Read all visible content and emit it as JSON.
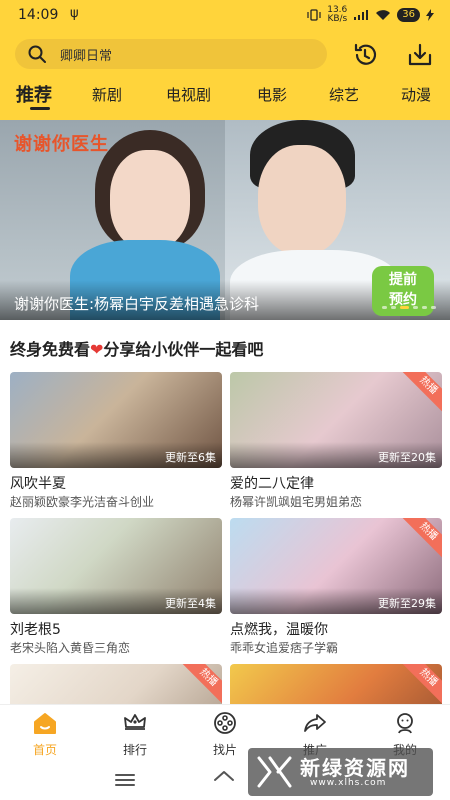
{
  "status_bar": {
    "time": "14:09",
    "usb": "ψ",
    "signal": "13.6\nKB/s",
    "battery": "36"
  },
  "search": {
    "text": "卿卿日常"
  },
  "tabs": [
    "推荐",
    "新剧",
    "电视剧",
    "电影",
    "综艺",
    "动漫"
  ],
  "banner": {
    "brand": "谢谢你医生",
    "caption": "谢谢你医生:杨幂白宇反差相遇急诊科",
    "badge": "提前\n预约"
  },
  "section_title": {
    "before": "终身免费看",
    "after": "分享给小伙伴一起看吧"
  },
  "cards": [
    {
      "title": "风吹半夏",
      "desc": "赵丽颖欧豪李光洁奋斗创业",
      "episodes": "更新至6集",
      "hot": ""
    },
    {
      "title": "爱的二八定律",
      "desc": "杨幂许凯飒姐宅男姐弟恋",
      "episodes": "更新至20集",
      "hot": "热播"
    },
    {
      "title": "刘老根5",
      "desc": "老宋头陷入黄昏三角恋",
      "episodes": "更新至4集",
      "hot": ""
    },
    {
      "title": "点燃我，温暖你",
      "desc": "乖乖女追爱痞子学霸",
      "episodes": "更新至29集",
      "hot": "热播"
    },
    {
      "title": "",
      "desc": "",
      "episodes": "",
      "hot": "热播"
    },
    {
      "title": "",
      "desc": "",
      "episodes": "",
      "hot": "热播"
    }
  ],
  "bottom_nav": [
    {
      "label": "首页",
      "icon": "home-icon"
    },
    {
      "label": "排行",
      "icon": "crown-icon"
    },
    {
      "label": "找片",
      "icon": "film-reel-icon"
    },
    {
      "label": "推广",
      "icon": "share-icon"
    },
    {
      "label": "我的",
      "icon": "profile-icon"
    }
  ],
  "watermark": {
    "title": "新绿资源网",
    "url": "www.xlhs.com"
  },
  "colors": {
    "accent": "#ffd43b",
    "active_nav": "#f6a623",
    "hot_tag": "#f26f5a"
  }
}
